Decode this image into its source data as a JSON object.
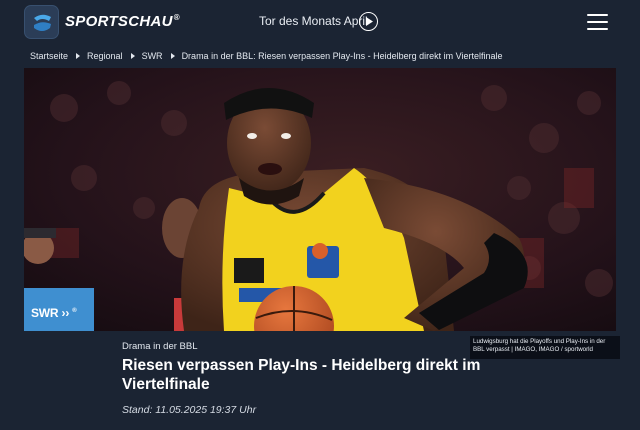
{
  "header": {
    "brand": "SPORTSCHAU",
    "brand_mark": "®",
    "promo_text": "Tor des Monats April",
    "icons": {
      "logo": "sportschau-s-logo-icon",
      "play": "play-icon",
      "menu": "hamburger-menu-icon"
    }
  },
  "breadcrumb": [
    "Startseite",
    "Regional",
    "SWR",
    "Drama in der BBL: Riesen verpassen Play-Ins - Heidelberg direkt im Viertelfinale"
  ],
  "hero": {
    "image_label": "basketball-player-photo",
    "broadcaster_badge": "SWR",
    "broadcaster_mark": "®",
    "caption": "Ludwigsburg hat die Playoffs und Play-Ins in der BBL verpasst | IMAGO, IMAGO / sportworld"
  },
  "article": {
    "kicker": "Drama in der BBL",
    "headline": "Riesen verpassen Play-Ins - Heidelberg direkt im Viertelfinale",
    "stand": "Stand: 11.05.2025 19:37 Uhr"
  },
  "colors": {
    "background": "#1b2433",
    "jersey": "#f2d21e",
    "ball": "#d9602a"
  }
}
